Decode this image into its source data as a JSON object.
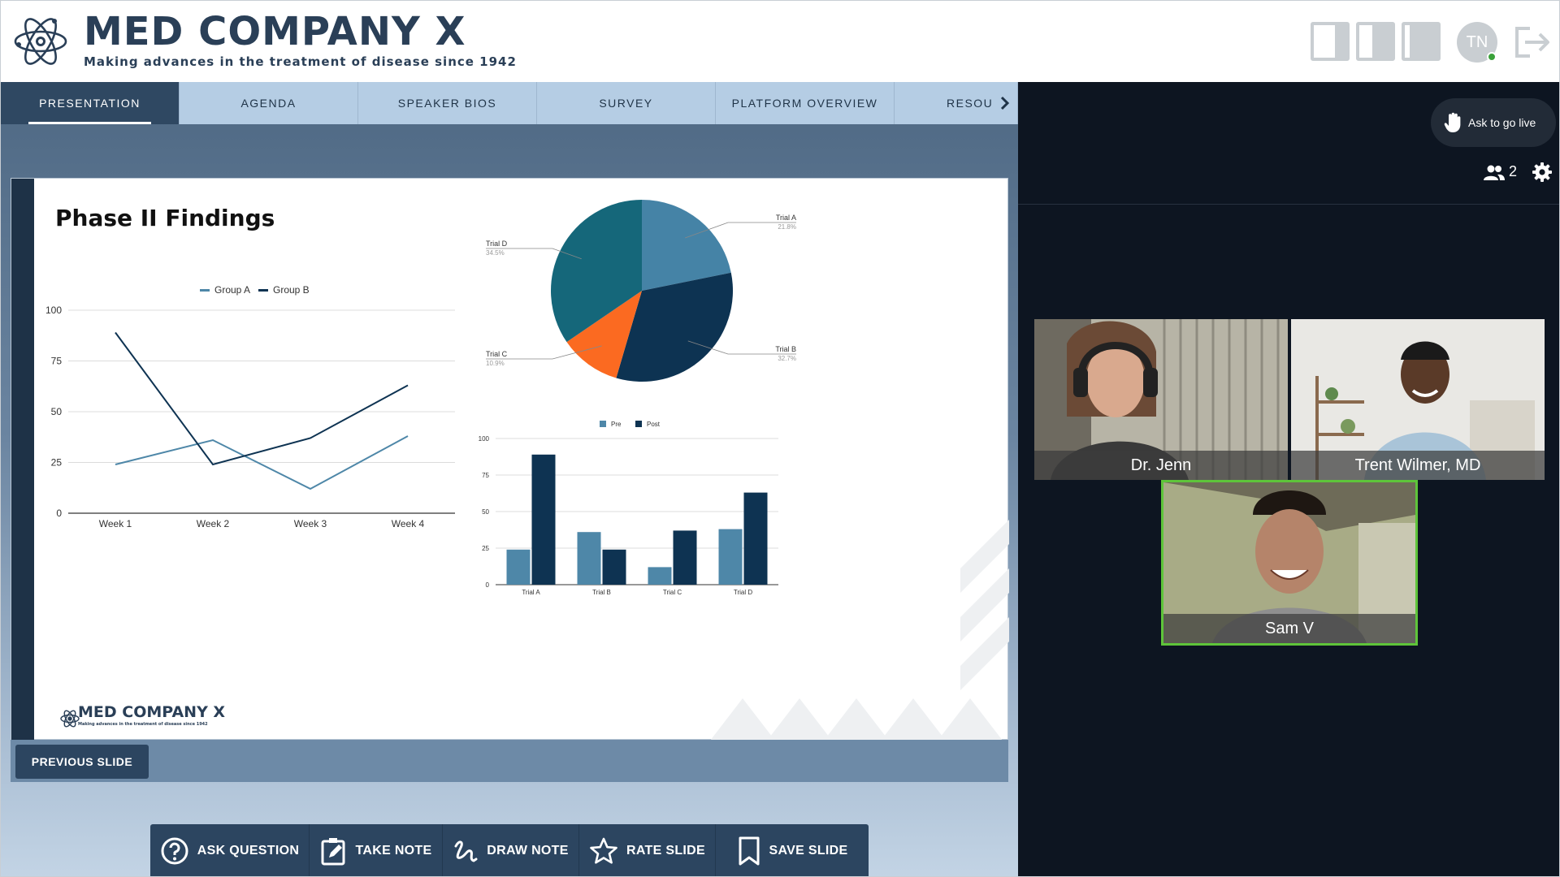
{
  "header": {
    "brand_title": "MED COMPANY X",
    "brand_tagline": "Making advances in the treatment of disease since 1942",
    "logo_icon": "atom-icon",
    "avatar_initials": "TN",
    "layout_icons": [
      "layout-left-panel-icon",
      "layout-split-icon",
      "layout-right-panel-icon"
    ],
    "exit_icon": "exit-icon"
  },
  "tabs": [
    {
      "label": "PRESENTATION",
      "active": true
    },
    {
      "label": "AGENDA",
      "active": false
    },
    {
      "label": "SPEAKER BIOS",
      "active": false
    },
    {
      "label": "SURVEY",
      "active": false
    },
    {
      "label": "PLATFORM OVERVIEW",
      "active": false
    },
    {
      "label": "RESOU",
      "active": false
    }
  ],
  "slide": {
    "title": "Phase II Findings",
    "footer_logo_text": "MED COMPANY X",
    "footer_logo_tagline": "Making advances in the treatment of disease since 1942"
  },
  "chart_data": [
    {
      "type": "line",
      "categories": [
        "Week 1",
        "Week 2",
        "Week 3",
        "Week 4"
      ],
      "series": [
        {
          "name": "Group A",
          "values": [
            24,
            36,
            12,
            38
          ],
          "color": "#4e87a8"
        },
        {
          "name": "Group B",
          "values": [
            89,
            24,
            37,
            63
          ],
          "color": "#0e3352"
        }
      ],
      "ylim": [
        0,
        100
      ],
      "yticks": [
        0,
        25,
        50,
        75,
        100
      ],
      "grid": true,
      "legend": "top-center"
    },
    {
      "type": "pie",
      "slices": [
        {
          "label": "Trial A",
          "value": 21.8,
          "display": "21.8%",
          "color": "#4583a6"
        },
        {
          "label": "Trial B",
          "value": 32.7,
          "display": "32.7%",
          "color": "#0d3352"
        },
        {
          "label": "Trial C",
          "value": 10.9,
          "display": "10.9%",
          "color": "#fb6a21"
        },
        {
          "label": "Trial D",
          "value": 34.5,
          "display": "34.5%",
          "color": "#15677a"
        }
      ]
    },
    {
      "type": "bar",
      "categories": [
        "Trial A",
        "Trial B",
        "Trial C",
        "Trial D"
      ],
      "series": [
        {
          "name": "Pre",
          "values": [
            24,
            36,
            12,
            38
          ],
          "color": "#4e87a8"
        },
        {
          "name": "Post",
          "values": [
            89,
            24,
            37,
            63
          ],
          "color": "#0e3352"
        }
      ],
      "ylim": [
        0,
        100
      ],
      "yticks": [
        0,
        25,
        50,
        75,
        100
      ],
      "grid": true,
      "legend": "top-center"
    }
  ],
  "controls": {
    "previous_slide": "PREVIOUS SLIDE"
  },
  "actions": [
    {
      "label": "ASK QUESTION",
      "icon": "question-circle-icon"
    },
    {
      "label": "TAKE NOTE",
      "icon": "edit-note-icon"
    },
    {
      "label": "DRAW NOTE",
      "icon": "draw-squiggle-icon"
    },
    {
      "label": "RATE SLIDE",
      "icon": "star-icon"
    },
    {
      "label": "SAVE SLIDE",
      "icon": "bookmark-icon"
    }
  ],
  "panel": {
    "go_live": "Ask to go live",
    "participant_count": "2",
    "participants": [
      {
        "name": "Dr. Jenn"
      },
      {
        "name": "Trent Wilmer, MD"
      },
      {
        "name": "Sam V",
        "active_speaker": true
      }
    ],
    "colors": {
      "active_speaker_border": "#5ec43a",
      "panel_bg": "#0d1521",
      "accent": "#2c4560"
    }
  }
}
